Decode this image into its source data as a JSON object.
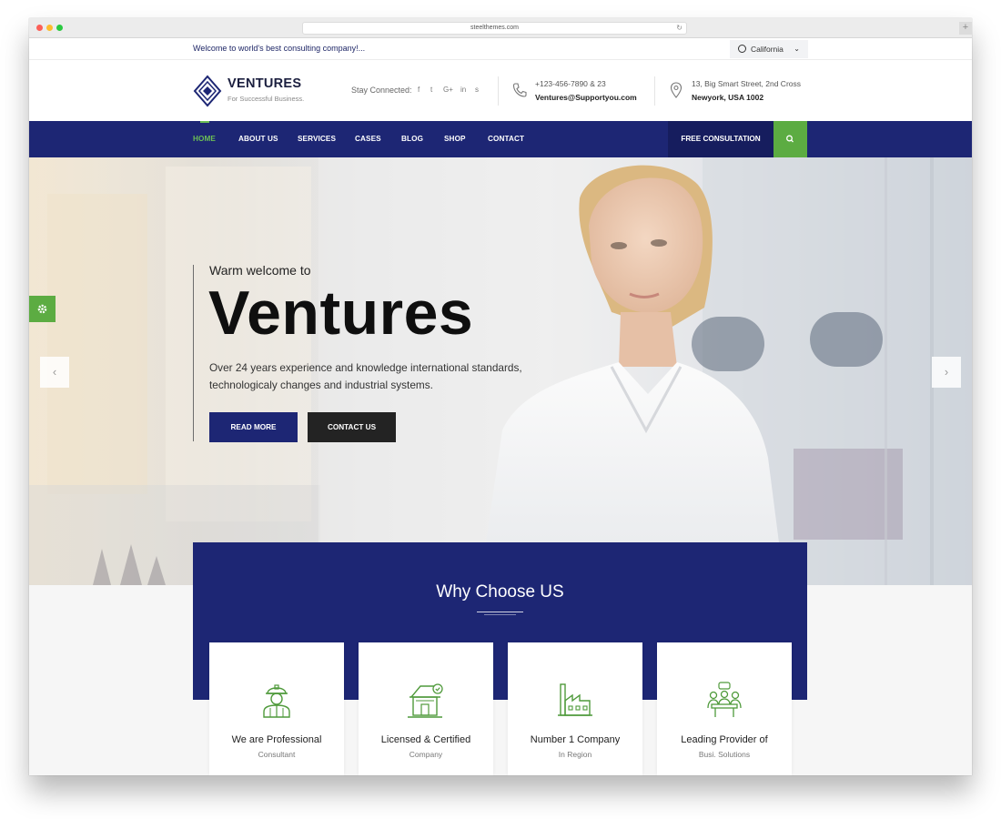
{
  "browser": {
    "url": "steelthemes.com"
  },
  "topbar": {
    "welcome": "Welcome to world's best consulting company!...",
    "language": "California"
  },
  "header": {
    "brand": "VENTURES",
    "tagline": "For Successful Business.",
    "stay_connected": "Stay Connected:",
    "social": [
      "f",
      "t",
      "G+",
      "in",
      "s"
    ],
    "phone": "+123-456-7890 & 23",
    "email": "Ventures@Supportyou.com",
    "address_line1": "13, Big Smart Street, 2nd Cross",
    "address_line2": "Newyork, USA 1002"
  },
  "nav": {
    "items": [
      "HOME",
      "ABOUT US",
      "SERVICES",
      "CASES",
      "BLOG",
      "SHOP",
      "CONTACT"
    ],
    "cta": "FREE CONSULTATION",
    "accent": "#5cac42",
    "bg": "#1d2674"
  },
  "hero": {
    "pretitle": "Warm welcome to",
    "title": "Ventures",
    "text_line1": "Over 24 years experience and knowledge international standards,",
    "text_line2": "technologicaly changes and industrial systems.",
    "btn_primary": "READ MORE",
    "btn_secondary": "CONTACT US"
  },
  "why": {
    "title": "Why Choose US",
    "cards": [
      {
        "title": "We are Professional",
        "sub": "Consultant",
        "icon": "worker-icon"
      },
      {
        "title": "Licensed & Certified",
        "sub": "Company",
        "icon": "certified-house-icon"
      },
      {
        "title": "Number 1 Company",
        "sub": "In Region",
        "icon": "factory-icon"
      },
      {
        "title": "Leading Provider of",
        "sub": "Busi. Solutions",
        "icon": "meeting-icon"
      }
    ]
  }
}
